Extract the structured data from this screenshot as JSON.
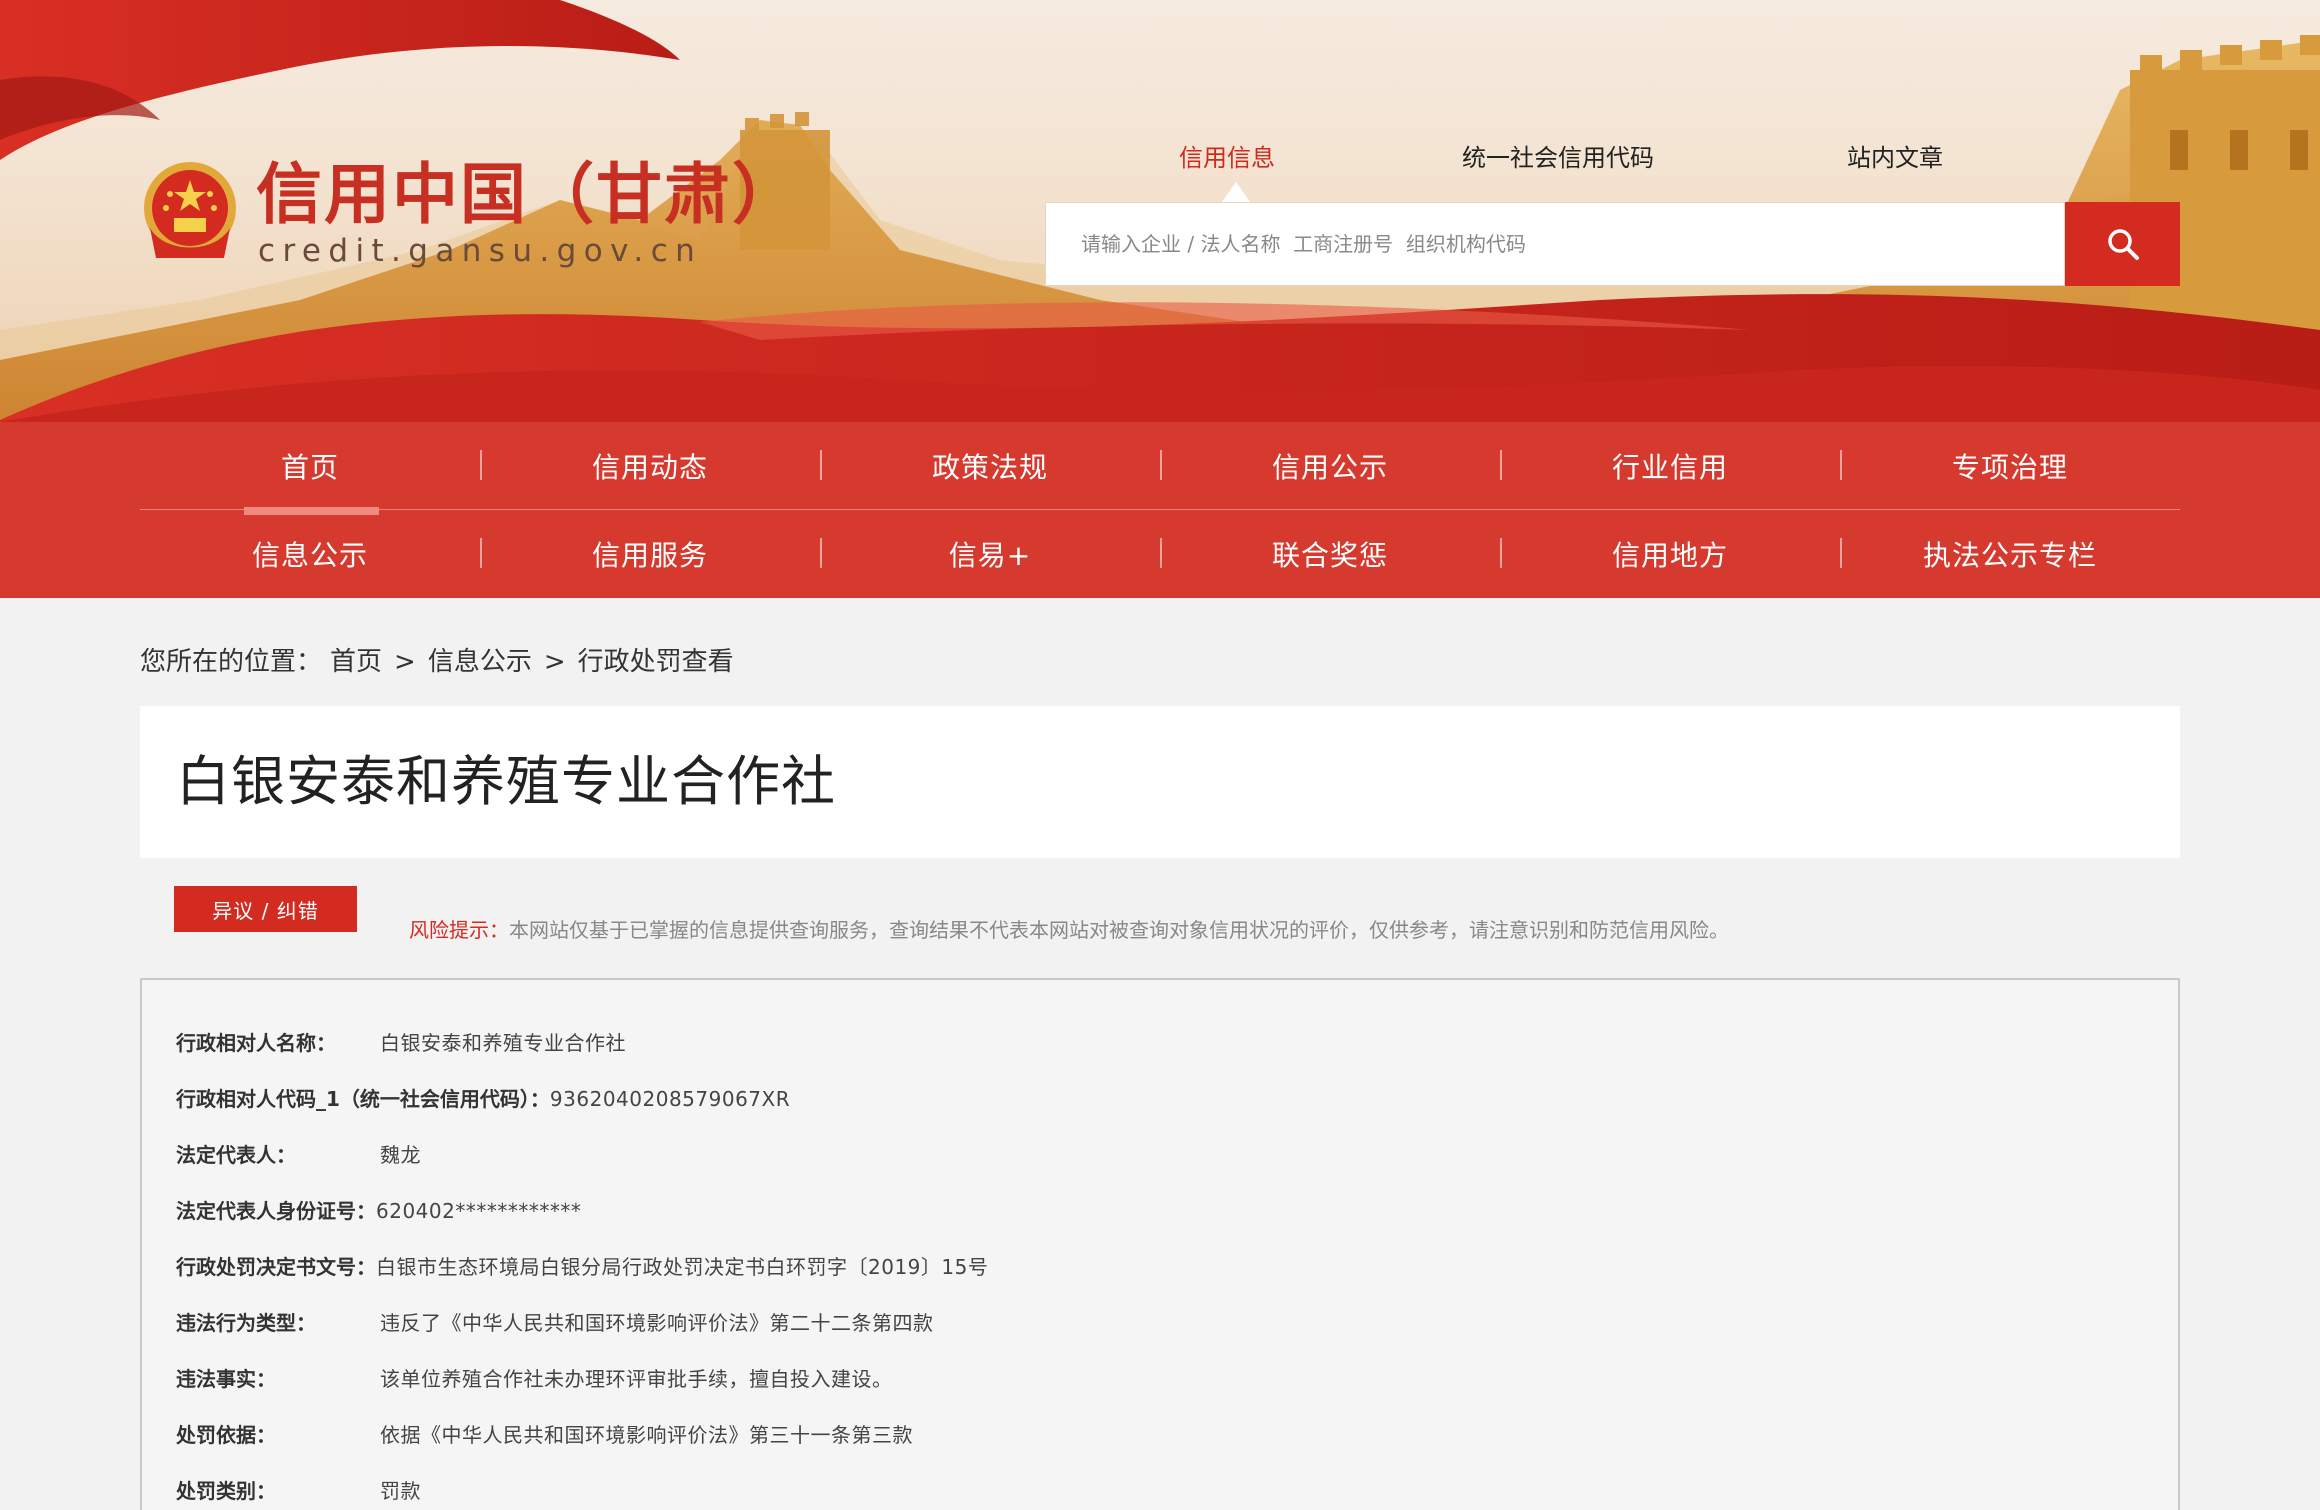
{
  "site": {
    "title": "信用中国（甘肃）",
    "domain": "credit.gansu.gov.cn"
  },
  "search": {
    "tabs": [
      "信用信息",
      "统一社会信用代码",
      "站内文章"
    ],
    "active_tab": "信用信息",
    "placeholder": "请输入企业 / 法人名称  工商注册号  组织机构代码",
    "button_icon": "search-icon"
  },
  "nav": {
    "row1": [
      "首页",
      "信用动态",
      "政策法规",
      "信用公示",
      "行业信用",
      "专项治理"
    ],
    "row2": [
      "信息公示",
      "信用服务",
      "信易+",
      "联合奖惩",
      "信用地方",
      "执法公示专栏"
    ],
    "active": "信息公示"
  },
  "breadcrumb": {
    "prefix": "您所在的位置：",
    "items": [
      "首页",
      "信息公示",
      "行政处罚查看"
    ],
    "separator": ">"
  },
  "entity": {
    "name": "白银安泰和养殖专业合作社"
  },
  "actions": {
    "dispute_label": "异议 / 纠错"
  },
  "risk": {
    "label": "风险提示：",
    "text": "本网站仅基于已掌握的信息提供查询服务，查询结果不代表本网站对被查询对象信用状况的评价，仅供参考，请注意识别和防范信用风险。"
  },
  "details": [
    {
      "key": "行政相对人名称：",
      "value": "白银安泰和养殖专业合作社"
    },
    {
      "key": "行政相对人代码_1（统一社会信用代码）：",
      "value": "9362040208579067XR"
    },
    {
      "key": "法定代表人：",
      "value": "魏龙"
    },
    {
      "key": "法定代表人身份证号：",
      "value": "620402************"
    },
    {
      "key": "行政处罚决定书文号：",
      "value": "白银市生态环境局白银分局行政处罚决定书白环罚字〔2019〕15号"
    },
    {
      "key": "违法行为类型：",
      "value": "违反了《中华人民共和国环境影响评价法》第二十二条第四款"
    },
    {
      "key": "违法事实：",
      "value": "该单位养殖合作社未办理环评审批手续，擅自投入建设。"
    },
    {
      "key": "处罚依据：",
      "value": "依据《中华人民共和国环境影响评价法》第三十一条第三款"
    },
    {
      "key": "处罚类别：",
      "value": "罚款"
    }
  ],
  "colors": {
    "brand_red": "#d42b21",
    "nav_red": "#d63a2f",
    "page_bg": "#f2f2f2"
  }
}
